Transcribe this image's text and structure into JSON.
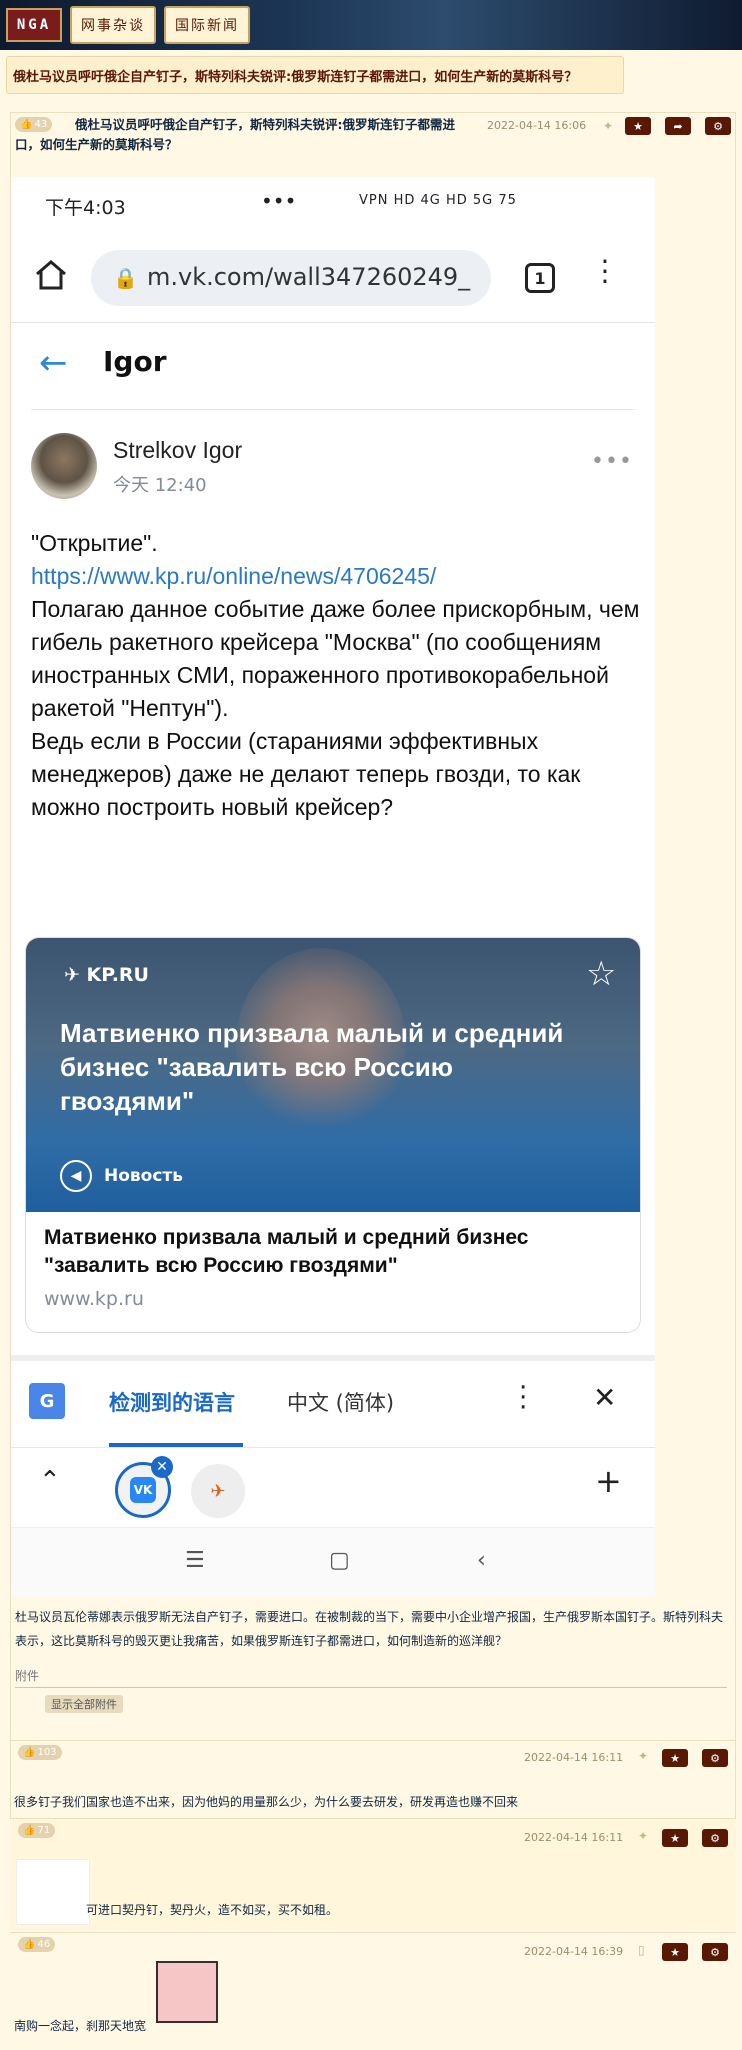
{
  "header": {
    "logo": "NGA",
    "nav": [
      "网事杂谈",
      "国际新闻"
    ]
  },
  "thread_title": "俄杜马议员呼吁俄企自产钉子，斯特列科夫锐评:俄罗斯连钉子都需进口，如何生产新的莫斯科号？",
  "main_post": {
    "likes": "43",
    "title": "俄杜马议员呼吁俄企自产钉子，斯特列科夫锐评:俄罗斯连钉子都需进口，如何生产新的莫斯科号？",
    "date": "2022-04-14 16:06",
    "screenshot": {
      "status_time": "下午4:03",
      "status_right": "VPN HD 4G HD 5G 75",
      "url": "m.vk.com/wall347260249_",
      "tab_count": "1",
      "page_name": "Igor",
      "author_name": "Strelkov Igor",
      "author_time": "今天 12:40",
      "post_lines": [
        "\"Открытие\".",
        "",
        "https://www.kp.ru/online/news/4706245/",
        "",
        "Полагаю данное событие даже более прискорбным, чем гибель ракетного крейсера \"Москва\" (по сообщениям иностранных СМИ, пораженного противокорабельной ракетой \"Нептун\").",
        "Ведь если в России (стараниями эффективных менеджеров) даже не делают теперь гвозди, то как можно построить новый крейсер?"
      ],
      "card": {
        "source_logo": "KP.RU",
        "headline": "Матвиенко призвала малый и средний бизнес \"завалить всю Россию гвоздями\"",
        "badge": "Новость",
        "title": "Матвиенко призвала малый и средний бизнес \"завалить всю Россию гвоздями\"",
        "domain": "www.kp.ru"
      },
      "translate": {
        "detected": "检测到的语言",
        "target": "中文 (简体)"
      },
      "tabs": {
        "vk_label": "VK",
        "kp_label": "✈"
      }
    },
    "body": "杜马议员瓦伦蒂娜表示俄罗斯无法自产钉子，需要进口。在被制裁的当下，需要中小企业增产报国，生产俄罗斯本国钉子。斯特列科夫表示，这比莫斯科号的毁灭更让我痛苦，如果俄罗斯连钉子都需进口，如何制造新的巡洋舰？",
    "attachments_label": "附件",
    "show_all_attachments": "显示全部附件"
  },
  "replies": [
    {
      "likes": "103",
      "date": "2022-04-14 16:11",
      "text": "很多钉子我们国家也造不出来，因为他妈的用量那么少，为什么要去研发，研发再造也赚不回来"
    },
    {
      "likes": "71",
      "date": "2022-04-14 16:11",
      "text": "可进口契丹钉，契丹火，造不如买，买不如租。"
    },
    {
      "likes": "46",
      "date": "2022-04-14 16:39",
      "text": "南购一念起，刹那天地宽"
    }
  ],
  "colors": {
    "page_bg": "#fff8e5",
    "accent_dark": "#591804",
    "vk_blue": "#2a89d8",
    "link_blue": "#2a79c3"
  },
  "icons": [
    "home-icon",
    "lock-icon",
    "back-arrow-icon",
    "star-icon",
    "translate-icon",
    "close-icon",
    "plus-icon",
    "chevron-up-icon",
    "more-icon"
  ]
}
